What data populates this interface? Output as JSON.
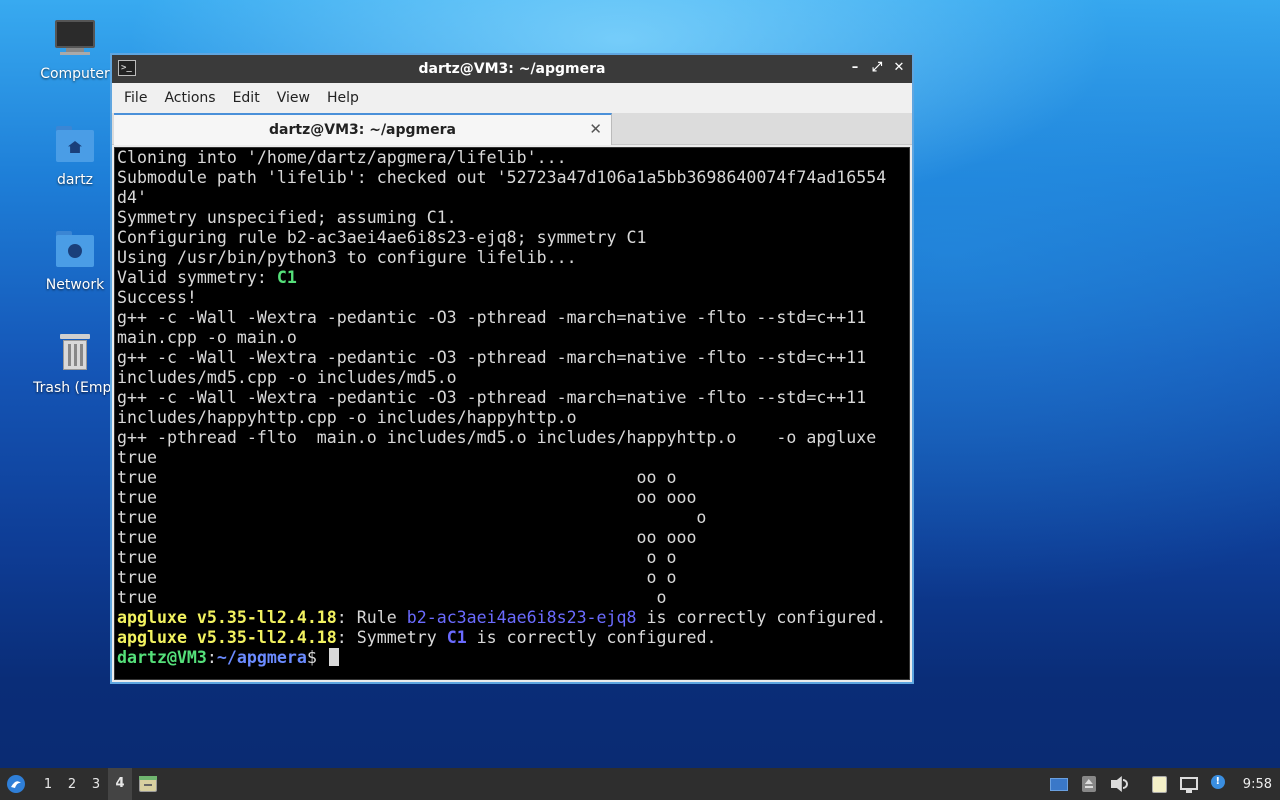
{
  "desktop": {
    "icons": [
      {
        "label": "Computer",
        "icon": "computer-icon"
      },
      {
        "label": "dartz",
        "icon": "home-folder-icon"
      },
      {
        "label": "Network",
        "icon": "network-folder-icon"
      },
      {
        "label": "Trash (Empt",
        "icon": "trash-icon"
      }
    ]
  },
  "window": {
    "title": "dartz@VM3: ~/apgmera",
    "controls": {
      "minimize": "–",
      "maximize": "⤢",
      "close": "✕"
    },
    "menu": [
      "File",
      "Actions",
      "Edit",
      "View",
      "Help"
    ],
    "tab": {
      "label": "dartz@VM3: ~/apgmera",
      "close": "✕"
    }
  },
  "terminal": {
    "lines": [
      "Cloning into '/home/dartz/apgmera/lifelib'...",
      "Submodule path 'lifelib': checked out '52723a47d106a1a5bb3698640074f74ad16554",
      "d4'",
      "Symmetry unspecified; assuming C1.",
      "Configuring rule b2-ac3aei4ae6i8s23-ejq8; symmetry C1",
      "Using /usr/bin/python3 to configure lifelib...",
      "g++ -c -Wall -Wextra -pedantic -O3 -pthread -march=native -flto --std=c++11",
      "main.cpp -o main.o",
      "g++ -c -Wall -Wextra -pedantic -O3 -pthread -march=native -flto --std=c++11",
      "includes/md5.cpp -o includes/md5.o",
      "g++ -c -Wall -Wextra -pedantic -O3 -pthread -march=native -flto --std=c++11",
      "includes/happyhttp.cpp -o includes/happyhttp.o",
      "g++ -pthread -flto  main.o includes/md5.o includes/happyhttp.o    -o apgluxe",
      "true",
      "true                                                oo o",
      "true                                                oo ooo",
      "true                                                      o",
      "true                                                oo ooo",
      "true                                                 o o",
      "true                                                 o o",
      "true                                                  o"
    ],
    "valid_symmetry_prefix": "Valid symmetry: ",
    "valid_symmetry_value": "C1",
    "success": "Success!",
    "rule_line": {
      "prog": "apgluxe v5.35-ll2.4.18",
      "mid": ": Rule ",
      "rule": "b2-ac3aei4ae6i8s23-ejq8",
      "end": " is correctly configured."
    },
    "sym_line": {
      "prog": "apgluxe v5.35-ll2.4.18",
      "mid": ": Symmetry ",
      "sym": "C1",
      "end": " is correctly configured."
    },
    "prompt": {
      "user": "dartz@VM3",
      "sep": ":",
      "path": "~/apgmera",
      "dollar": "$ "
    }
  },
  "taskbar": {
    "workspaces": [
      "1",
      "2",
      "3",
      "4"
    ],
    "active_workspace": "4",
    "clock": "9:58"
  },
  "colors": {
    "terminal_bg": "#000000",
    "green": "#55e07a",
    "yellow": "#f2f260",
    "blue": "#6b6bff",
    "window_border": "#5fa6e0"
  }
}
